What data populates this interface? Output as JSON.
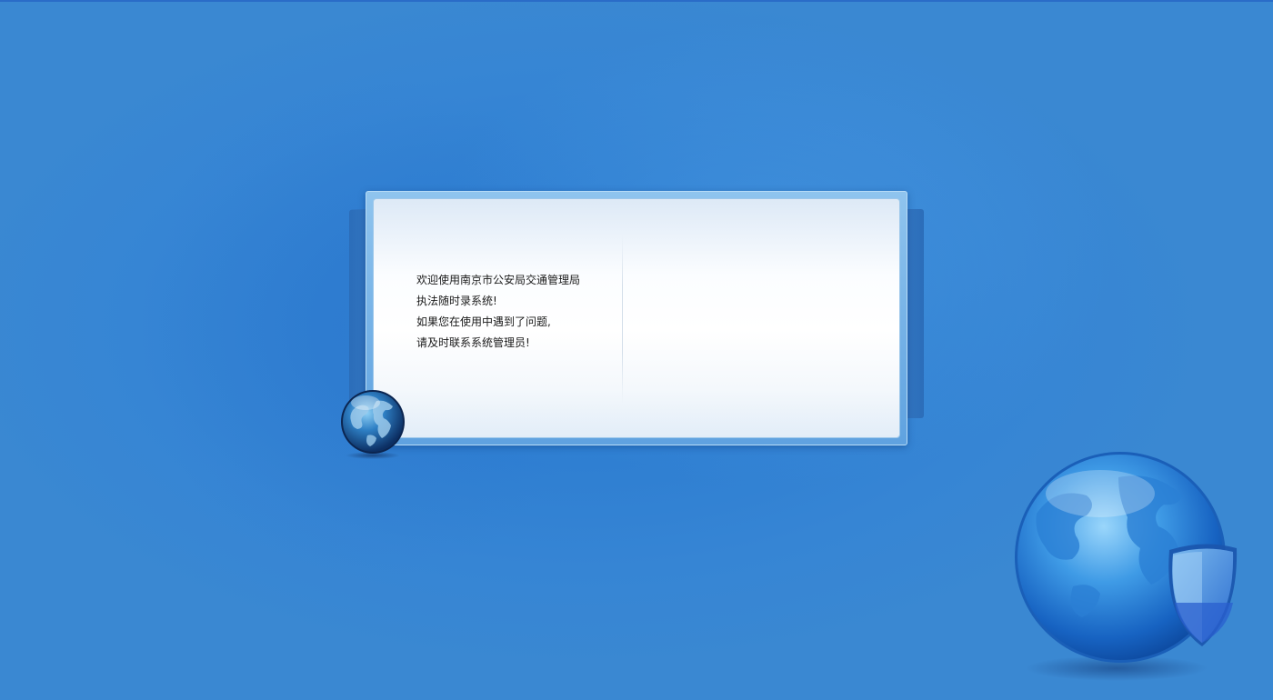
{
  "welcome_panel": {
    "lines": [
      "欢迎使用南京市公安局交通管理局",
      "执法随时录系统!",
      "如果您在使用中遇到了问题,",
      "请及时联系系统管理员!"
    ]
  },
  "decor": {
    "small_globe_icon": "globe-icon",
    "big_globe_icon": "globe-shield-icon"
  },
  "colors": {
    "background": "#2f7fd2",
    "panel_frame": "#6aaae3",
    "text": "#1a1a1a"
  }
}
